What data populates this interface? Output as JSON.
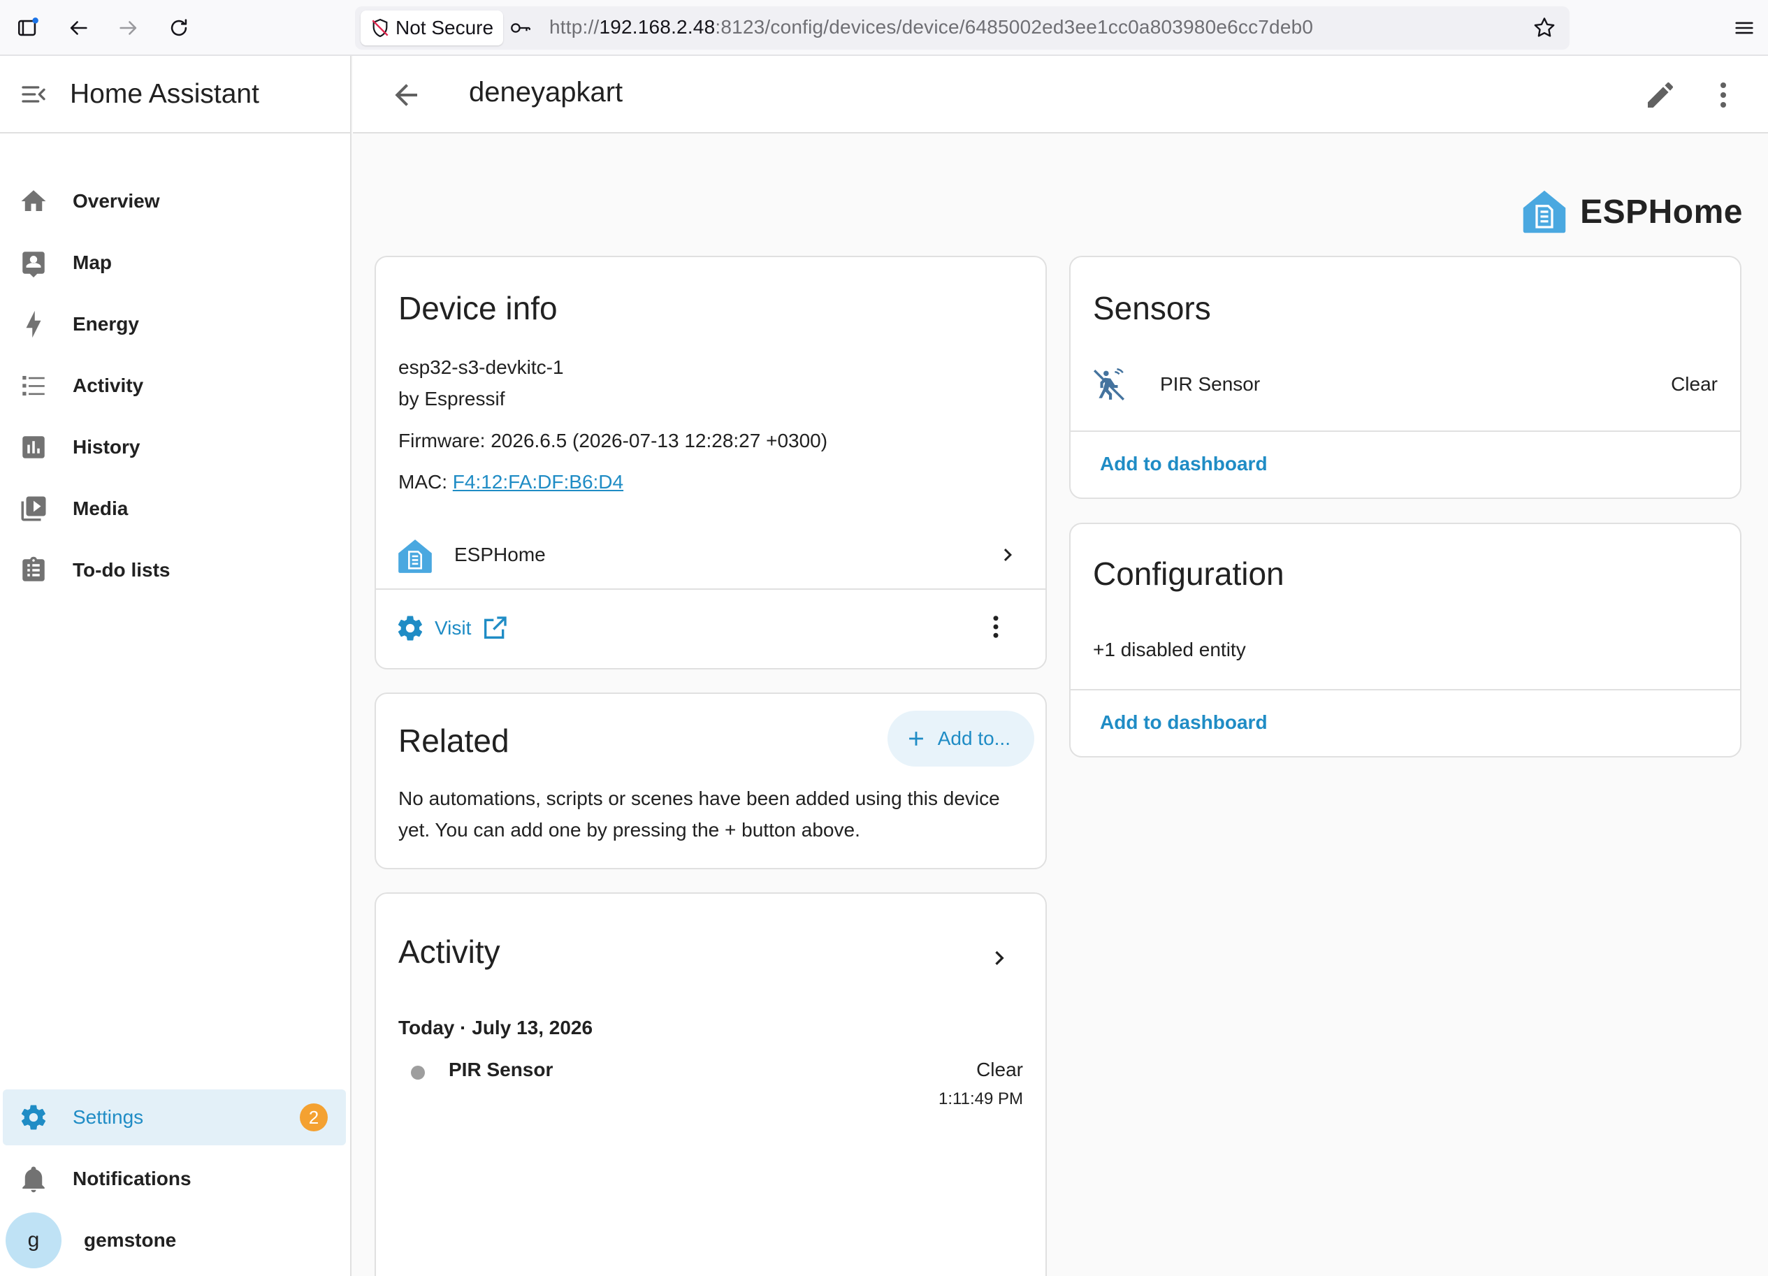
{
  "browser": {
    "security_label": "Not Secure",
    "url_prefix": "http://",
    "url_host": "192.168.2.48",
    "url_rest": ":8123/config/devices/device/6485002ed3ee1cc0a803980e6cc7deb0"
  },
  "sidebar": {
    "title": "Home Assistant",
    "items": [
      {
        "label": "Overview",
        "icon": "home-icon"
      },
      {
        "label": "Map",
        "icon": "map-account-icon"
      },
      {
        "label": "Energy",
        "icon": "lightning-icon"
      },
      {
        "label": "Activity",
        "icon": "list-icon"
      },
      {
        "label": "History",
        "icon": "chart-box-icon"
      },
      {
        "label": "Media",
        "icon": "play-box-icon"
      },
      {
        "label": "To-do lists",
        "icon": "clipboard-list-icon"
      }
    ],
    "settings": {
      "label": "Settings",
      "badge": "2"
    },
    "notifications": {
      "label": "Notifications"
    },
    "user": {
      "initial": "g",
      "name": "gemstone"
    }
  },
  "appbar": {
    "title": "deneyapkart"
  },
  "brand": {
    "name": "ESPHome"
  },
  "device_info": {
    "title": "Device info",
    "model": "esp32-s3-devkitc-1",
    "manufacturer": "by Espressif",
    "firmware": "Firmware: 2026.6.5 (2026-07-13 12:28:27 +0300)",
    "mac_label": "MAC: ",
    "mac_value": "F4:12:FA:DF:B6:D4",
    "integration": "ESPHome",
    "visit_label": "Visit"
  },
  "related": {
    "title": "Related",
    "add_label": "Add to...",
    "message_line1": "No automations, scripts or scenes have been added using this device",
    "message_line2": "yet. You can add one by pressing the + button above."
  },
  "activity": {
    "title": "Activity",
    "date": "Today · July 13, 2026",
    "entries": [
      {
        "name": "PIR Sensor",
        "state": "Clear",
        "time": "1:11:49 PM"
      }
    ]
  },
  "sensors": {
    "title": "Sensors",
    "items": [
      {
        "name": "PIR Sensor",
        "state": "Clear"
      }
    ],
    "add_dashboard": "Add to dashboard"
  },
  "configuration": {
    "title": "Configuration",
    "disabled": "+1 disabled entity",
    "add_dashboard": "Add to dashboard"
  },
  "colors": {
    "accent": "#1f8cc5",
    "badge": "#f4a131",
    "esphome": "#4aa8e0"
  }
}
